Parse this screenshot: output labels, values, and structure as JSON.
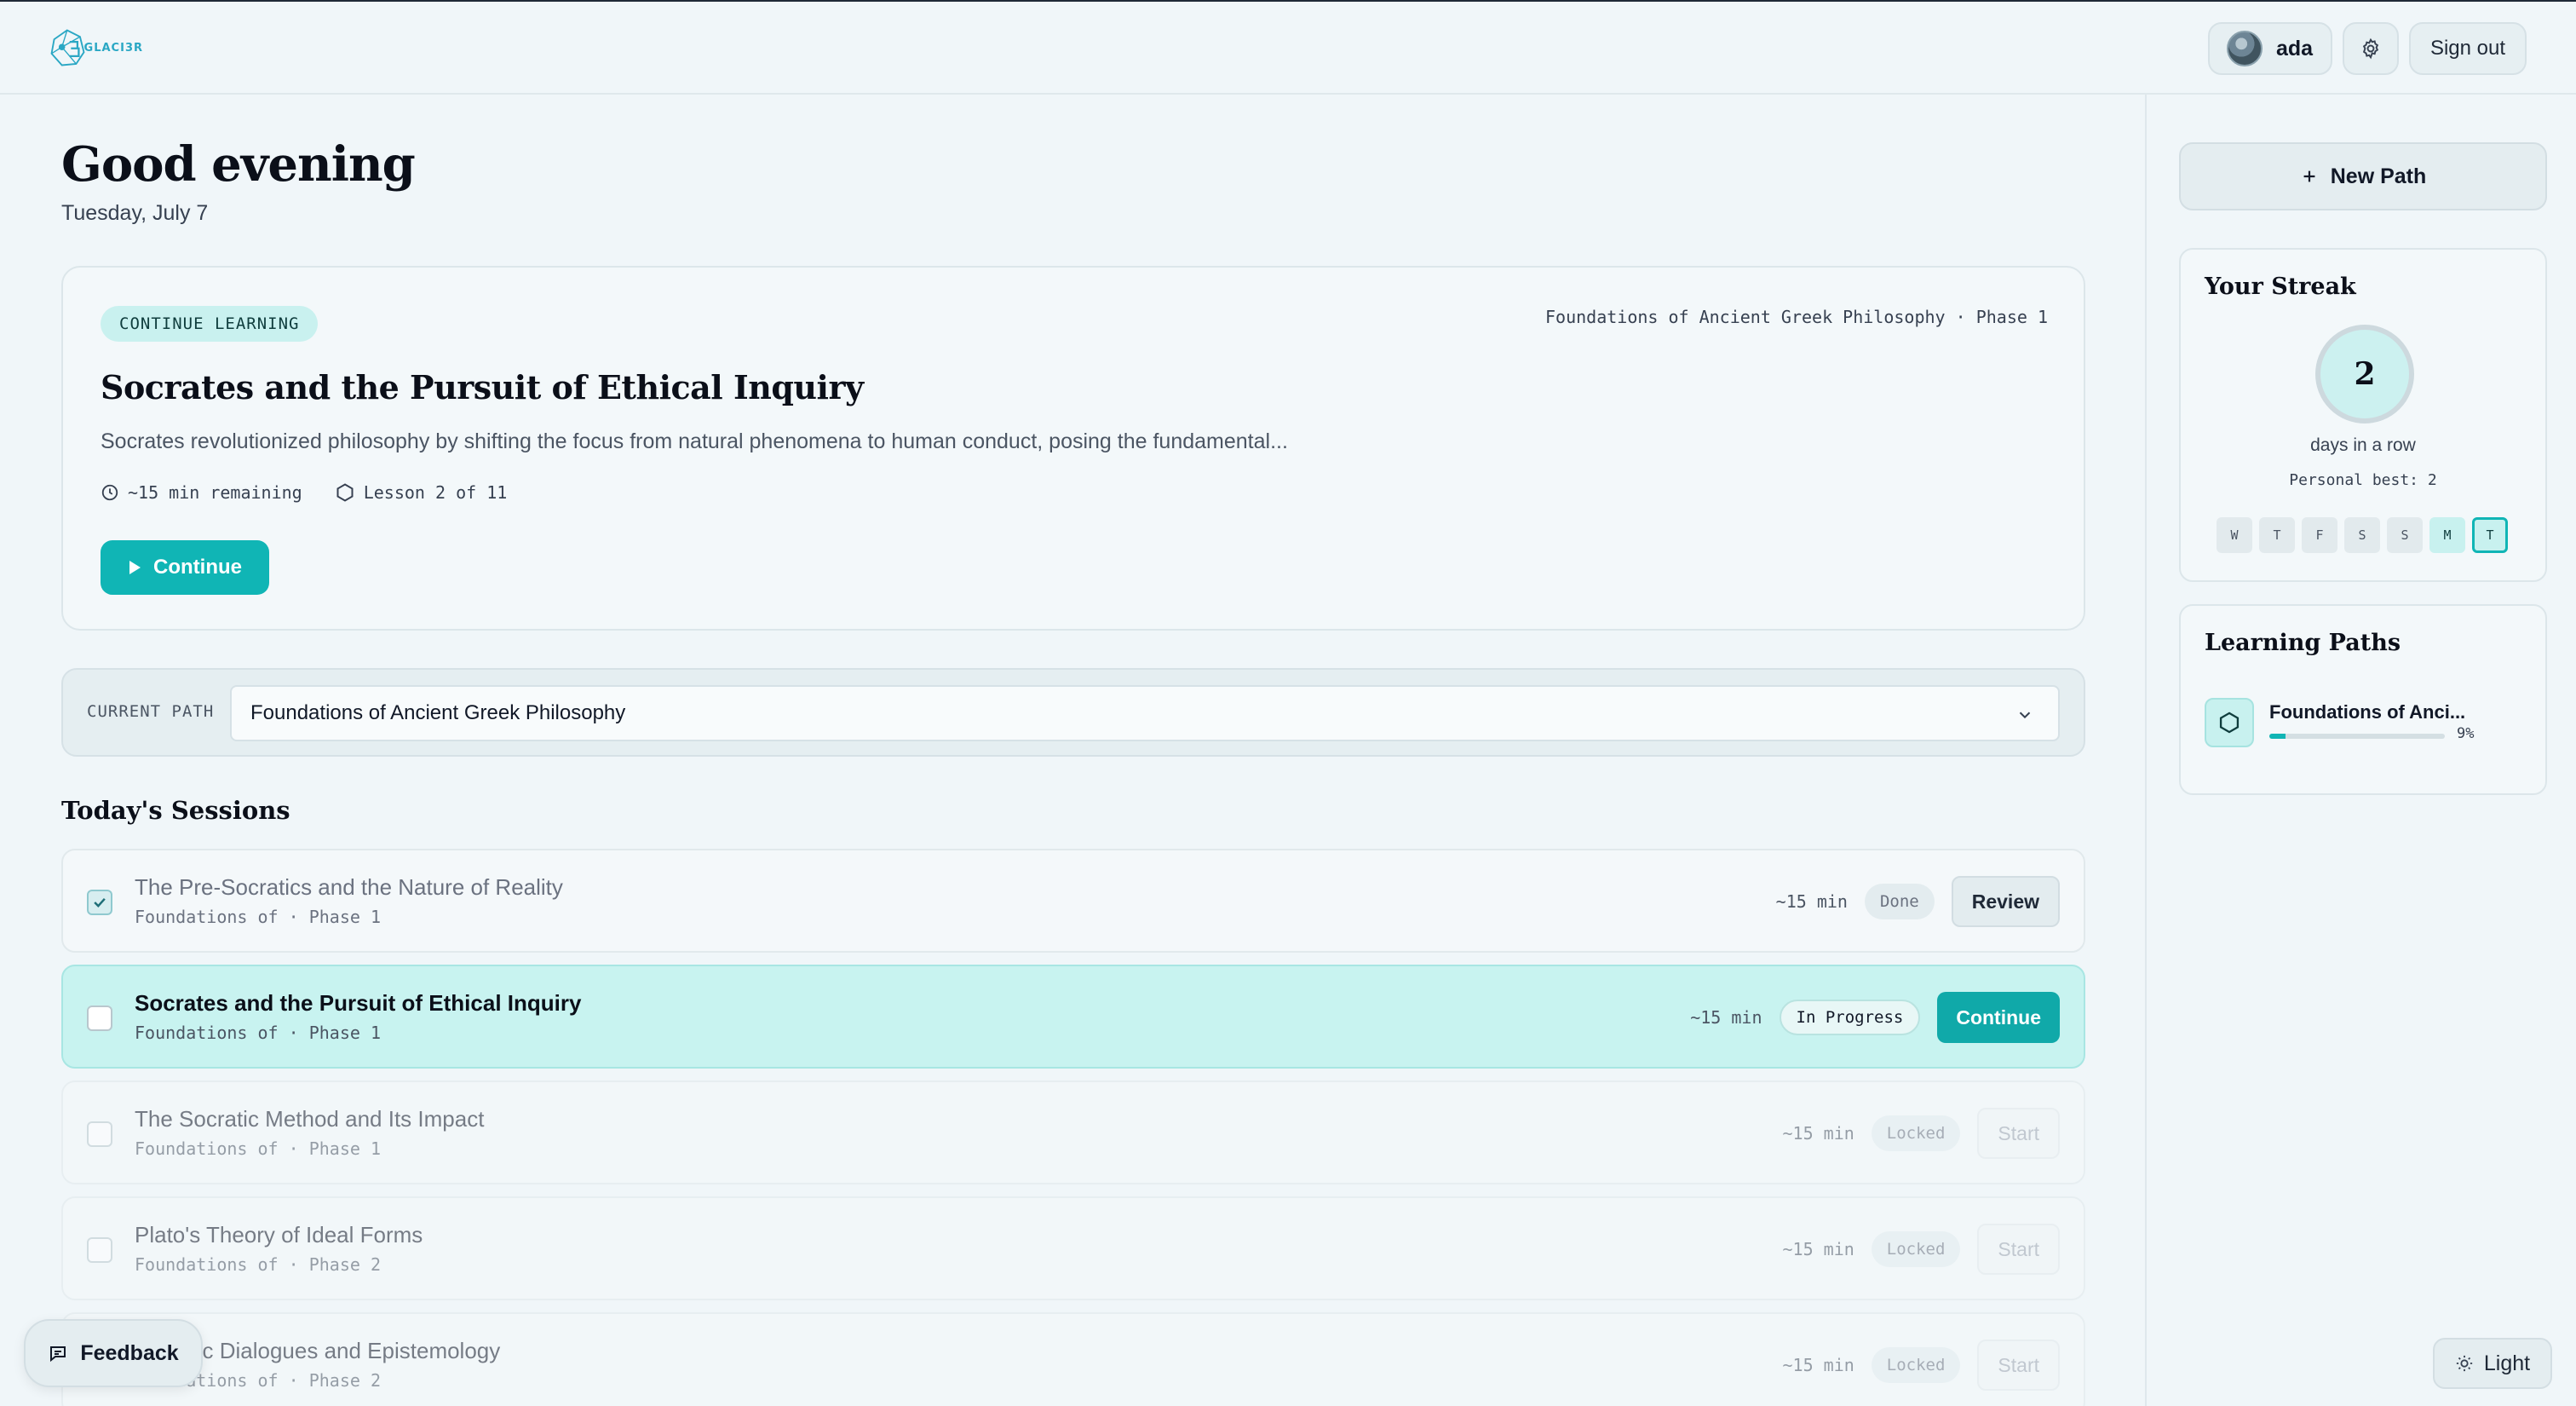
{
  "header": {
    "logo_text": "GLACI3R",
    "username": "ada",
    "signout_label": "Sign out"
  },
  "greeting": {
    "title": "Good evening",
    "date": "Tuesday, July 7"
  },
  "hero": {
    "tag": "CONTINUE LEARNING",
    "meta": "Foundations of Ancient Greek Philosophy · Phase 1",
    "title": "Socrates and the Pursuit of Ethical Inquiry",
    "description": "Socrates revolutionized philosophy by shifting the focus from natural phenomena to human conduct, posing the fundamental...",
    "time_remaining": "~15 min remaining",
    "lesson_progress": "Lesson 2 of 11",
    "continue_label": "Continue"
  },
  "current_path": {
    "label": "CURRENT PATH",
    "selected": "Foundations of Ancient Greek Philosophy"
  },
  "sessions": {
    "title": "Today's Sessions",
    "items": [
      {
        "title": "The Pre-Socratics and the Nature of Reality",
        "subtitle": "Foundations of · Phase 1",
        "duration": "~15 min",
        "status": "Done",
        "action": "Review"
      },
      {
        "title": "Socrates and the Pursuit of Ethical Inquiry",
        "subtitle": "Foundations of · Phase 1",
        "duration": "~15 min",
        "status": "In Progress",
        "action": "Continue"
      },
      {
        "title": "The Socratic Method and Its Impact",
        "subtitle": "Foundations of · Phase 1",
        "duration": "~15 min",
        "status": "Locked",
        "action": "Start"
      },
      {
        "title": "Plato's Theory of Ideal Forms",
        "subtitle": "Foundations of · Phase 2",
        "duration": "~15 min",
        "status": "Locked",
        "action": "Start"
      },
      {
        "title": "Platonic Dialogues and Epistemology",
        "subtitle": "Foundations of · Phase 2",
        "duration": "~15 min",
        "status": "Locked",
        "action": "Start"
      }
    ]
  },
  "sidebar": {
    "new_path_label": "New Path",
    "streak": {
      "title": "Your Streak",
      "count": "2",
      "caption": "days in a row",
      "best": "Personal best: 2",
      "days": [
        "W",
        "T",
        "F",
        "S",
        "S",
        "M",
        "T"
      ],
      "active_days": [
        5,
        6
      ],
      "today_index": 6
    },
    "learning_paths": {
      "title": "Learning Paths",
      "items": [
        {
          "name": "Foundations of Anci...",
          "percent_label": "9%",
          "progress": 0.09
        }
      ]
    }
  },
  "feedback_label": "Feedback",
  "theme_label": "Light",
  "colors": {
    "accent": "#10b5b5",
    "accent_soft": "#c8f3f0",
    "background": "#f0f6f9"
  }
}
